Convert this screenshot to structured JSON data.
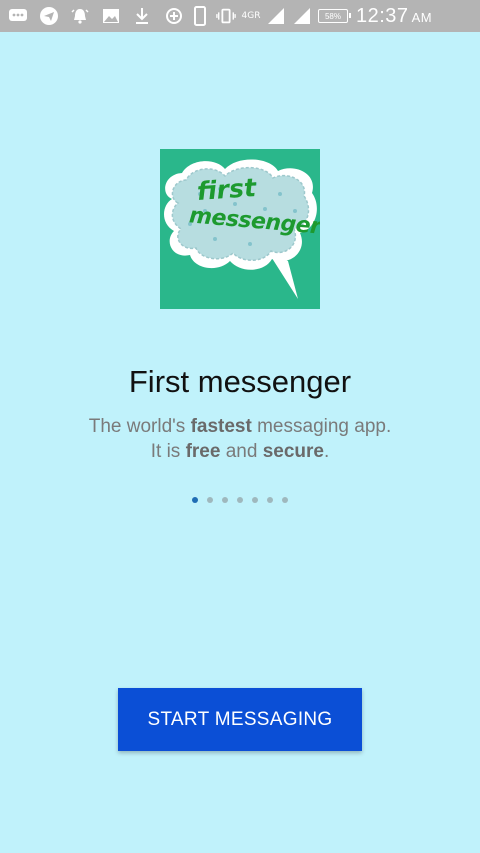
{
  "status_bar": {
    "time": "12:37",
    "ampm": "AM",
    "network": "4GR",
    "battery": "58%",
    "left_icons": [
      "message-icon",
      "telegram-icon",
      "alarm-icon",
      "image-icon",
      "download-icon"
    ],
    "right_icons": [
      "data-saver-icon",
      "phone-icon",
      "vibrate-icon",
      "signal-icon",
      "signal-icon",
      "battery-icon"
    ]
  },
  "logo": {
    "line1": "first",
    "line2": "messenger",
    "background_color": "#2ab78b",
    "text_color": "#1d9a2f"
  },
  "intro": {
    "title": "First messenger",
    "subtitle_line1_pre": "The world's ",
    "subtitle_line1_bold": "fastest",
    "subtitle_line1_post": " messaging app.",
    "subtitle_line2_pre": "It is ",
    "subtitle_line2_bold1": "free",
    "subtitle_line2_mid": " and ",
    "subtitle_line2_bold2": "secure",
    "subtitle_line2_post": "."
  },
  "pager": {
    "total": 7,
    "active_index": 0
  },
  "start_button": {
    "label": "START MESSAGING",
    "color": "#0b4fd6"
  },
  "colors": {
    "background": "#c0f2fb",
    "status_bar": "#b4b4b4"
  }
}
